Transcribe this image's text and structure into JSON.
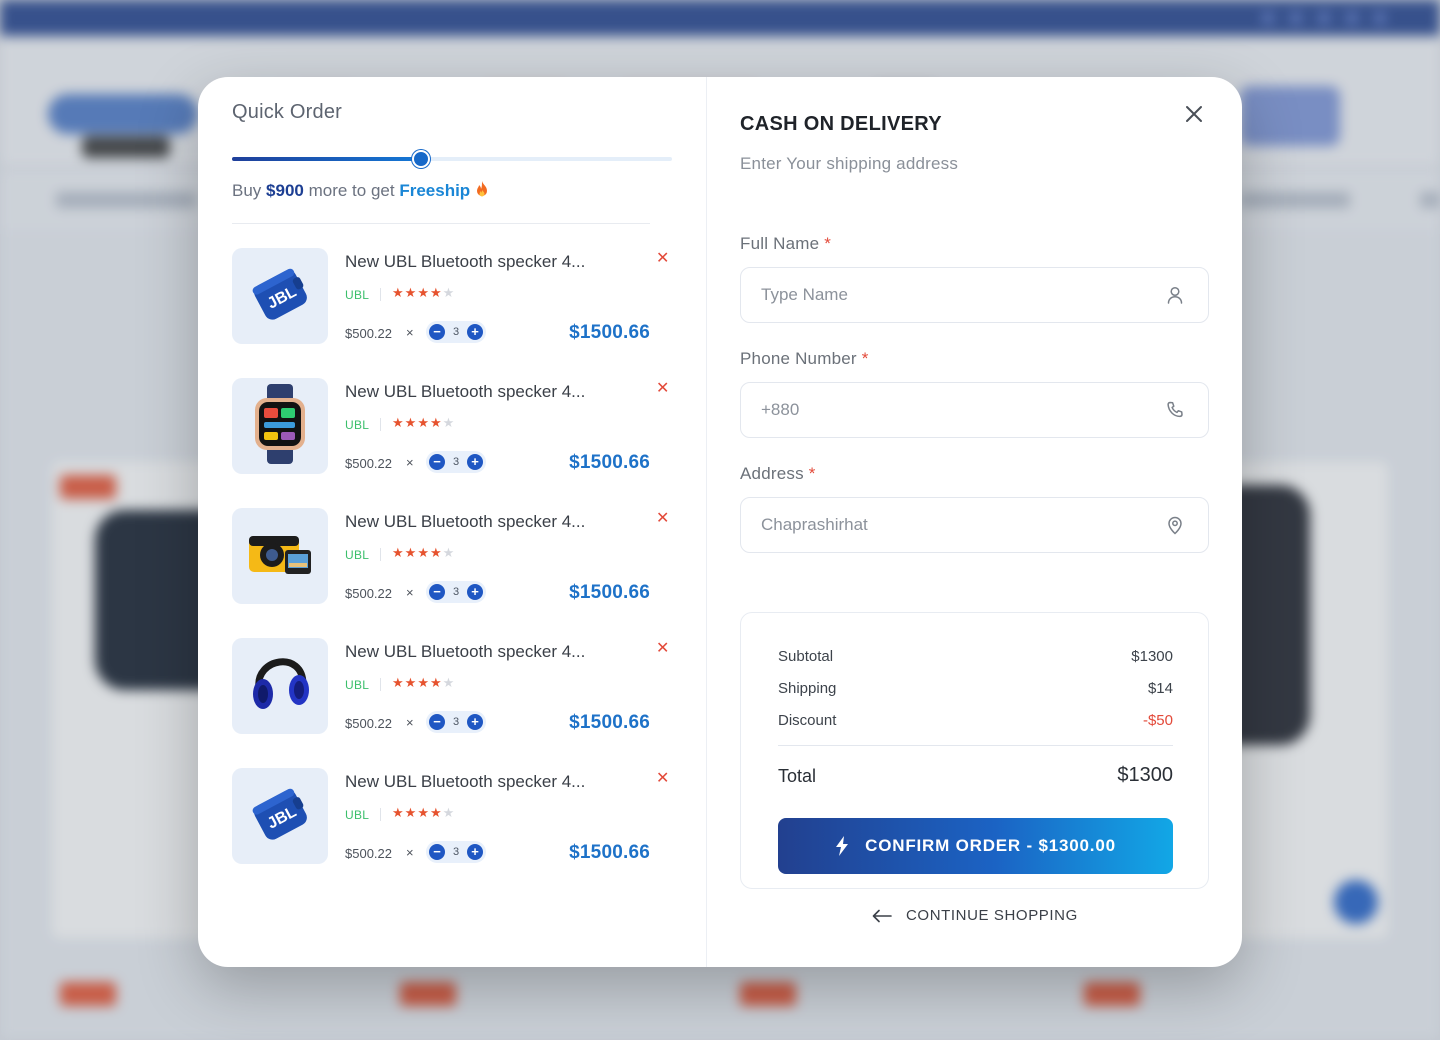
{
  "quick_order": {
    "title": "Quick Order",
    "progress_fraction": 0.43,
    "freeship_prefix": "Buy",
    "freeship_amount": "$900",
    "freeship_middle": "more to get",
    "freeship_label": "Freeship",
    "freeship_icon": "fire-icon",
    "items": [
      {
        "name": "New UBL Bluetooth specker 4...",
        "brand": "UBL",
        "rating": 4,
        "rating_max": 5,
        "unit_price": "$500.22",
        "times": "×",
        "qty": "3",
        "total": "$1500.66",
        "remove": "✕",
        "image": "speaker-icon"
      },
      {
        "name": "New UBL Bluetooth specker 4...",
        "brand": "UBL",
        "rating": 4,
        "rating_max": 5,
        "unit_price": "$500.22",
        "times": "×",
        "qty": "3",
        "total": "$1500.66",
        "remove": "✕",
        "image": "smartwatch-icon"
      },
      {
        "name": "New UBL Bluetooth specker 4...",
        "brand": "UBL",
        "rating": 4,
        "rating_max": 5,
        "unit_price": "$500.22",
        "times": "×",
        "qty": "3",
        "total": "$1500.66",
        "remove": "✕",
        "image": "camera-icon"
      },
      {
        "name": "New UBL Bluetooth specker 4...",
        "brand": "UBL",
        "rating": 4,
        "rating_max": 5,
        "unit_price": "$500.22",
        "times": "×",
        "qty": "3",
        "total": "$1500.66",
        "remove": "✕",
        "image": "headphones-icon"
      },
      {
        "name": "New UBL Bluetooth specker 4...",
        "brand": "UBL",
        "rating": 4,
        "rating_max": 5,
        "unit_price": "$500.22",
        "times": "×",
        "qty": "3",
        "total": "$1500.66",
        "remove": "✕",
        "image": "speaker-icon"
      }
    ]
  },
  "checkout": {
    "title": "CASH ON DELIVERY",
    "subtitle": "Enter Your shipping address",
    "close_icon": "close-icon",
    "required_mark": "*",
    "fields": {
      "full_name": {
        "label": "Full Name",
        "value": "",
        "placeholder": "Type Name",
        "icon": "user-icon"
      },
      "phone": {
        "label": "Phone Number",
        "value": "",
        "placeholder": "+880",
        "icon": "phone-icon"
      },
      "address": {
        "label": "Address",
        "value": "",
        "placeholder": "Chaprashirhat",
        "icon": "location-pin-icon"
      }
    },
    "summary": {
      "subtotal_label": "Subtotal",
      "subtotal": "$1300",
      "shipping_label": "Shipping",
      "shipping": "$14",
      "discount_label": "Discount",
      "discount": "-$50",
      "total_label": "Total",
      "total": "$1300"
    },
    "confirm_label": "CONFIRM ORDER - $1300.00",
    "confirm_icon": "bolt-icon",
    "continue_label": "CONTINUE SHOPPING",
    "continue_icon": "arrow-left-icon"
  },
  "colors": {
    "brand_blue": "#1d3f93",
    "price_blue": "#1e72c8",
    "danger": "#e34a3a",
    "brand_green": "#3bbf6b",
    "star": "#e6532f"
  }
}
